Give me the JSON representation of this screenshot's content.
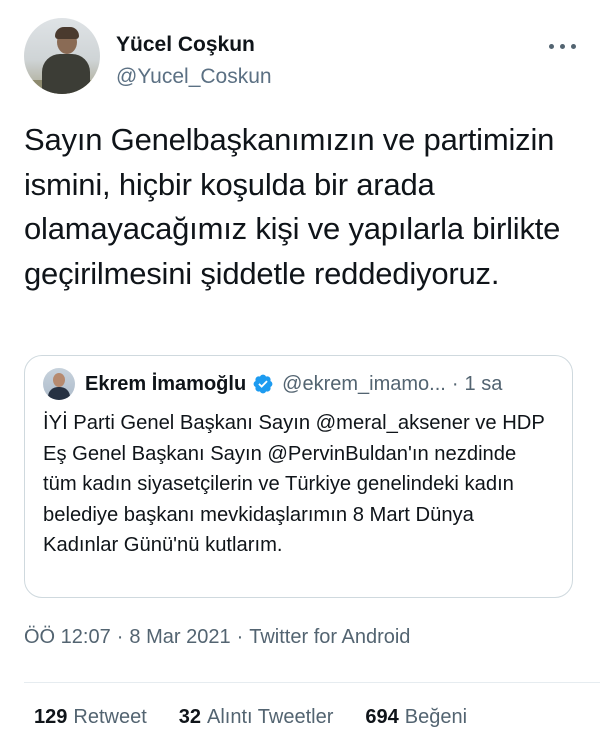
{
  "author": {
    "display_name": "Yücel Coşkun",
    "handle": "@Yucel_Coskun"
  },
  "tweet": {
    "text": "Sayın Genelbaşkanımızın ve partimizin ismini, hiçbir koşulda bir arada olamayacağımız kişi ve yapılarla birlikte geçirilmesini şiddetle reddediyoruz."
  },
  "quoted_tweet": {
    "display_name": "Ekrem İmamoğlu",
    "verified": true,
    "handle": "@ekrem_imamo...",
    "separator": "·",
    "time": "1 sa",
    "text": "İYİ Parti Genel Başkanı Sayın @meral_aksener ve HDP Eş Genel Başkanı Sayın @PervinBuldan'ın nezdinde tüm kadın siyasetçilerin ve Türkiye genelindeki kadın belediye başkanı mevkidaşlarımın 8 Mart Dünya Kadınlar Günü'nü kutlarım."
  },
  "meta": {
    "time": "ÖÖ 12:07",
    "separator": "·",
    "date": "8 Mar 2021",
    "client": "Twitter for Android"
  },
  "stats": {
    "retweets": {
      "count": "129",
      "label": "Retweet"
    },
    "quotes": {
      "count": "32",
      "label": "Alıntı Tweetler"
    },
    "likes": {
      "count": "694",
      "label": "Beğeni"
    }
  },
  "colors": {
    "text_primary": "#0f1419",
    "text_secondary": "#536471",
    "verified_blue": "#1d9bf0",
    "border": "#cfd9de"
  },
  "icons": {
    "more": "more-horizontal-icon",
    "verified": "verified-badge-icon"
  }
}
